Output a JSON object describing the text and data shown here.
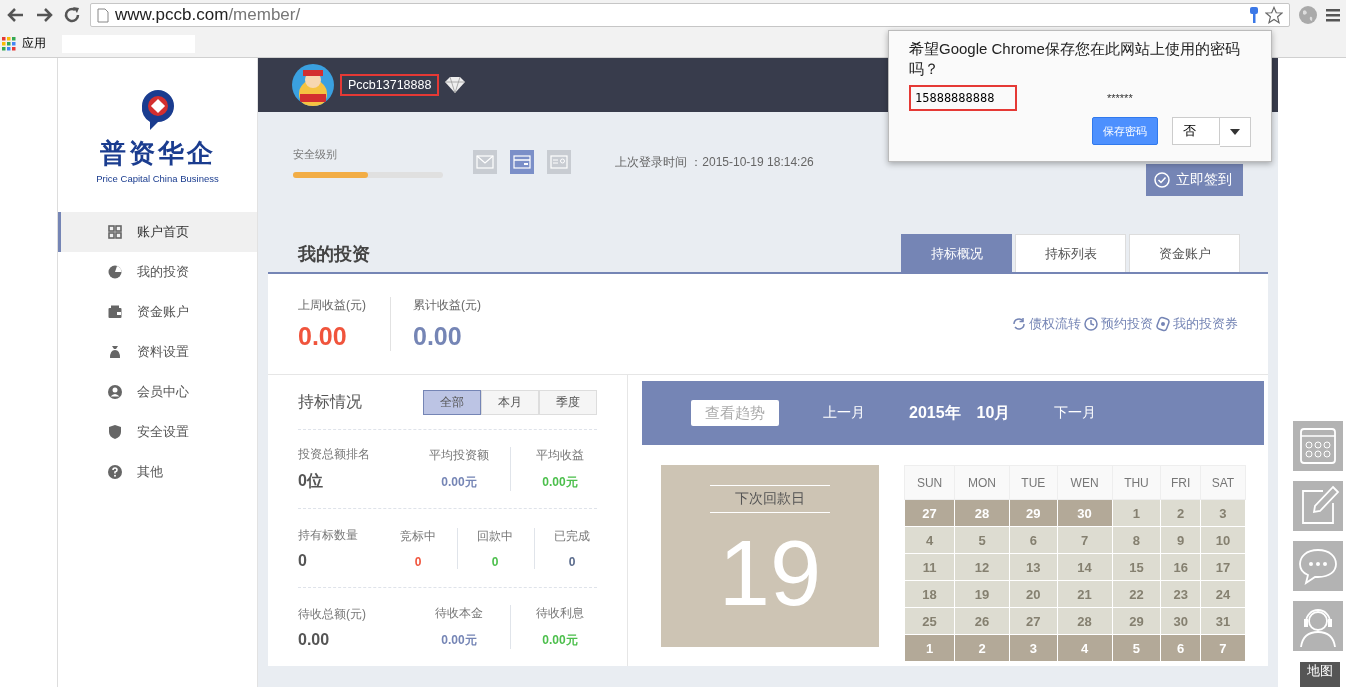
{
  "browser": {
    "url_host": "www.pccb.com",
    "url_path": "/member/",
    "bookmarks": [
      {
        "label": "应用"
      }
    ]
  },
  "sidebar": {
    "logo_name": "普资华企",
    "logo_tagline": "Price Capital China Business",
    "items": [
      {
        "kind": "grid",
        "label": "账户首页",
        "selected": true
      },
      {
        "kind": "pie",
        "label": "我的投资",
        "selected": false
      },
      {
        "kind": "wallet",
        "label": "资金账户",
        "selected": false
      },
      {
        "kind": "bag",
        "label": "资料设置",
        "selected": false
      },
      {
        "kind": "user",
        "label": "会员中心",
        "selected": false
      },
      {
        "kind": "shield",
        "label": "安全设置",
        "selected": false
      },
      {
        "kind": "help",
        "label": "其他",
        "selected": false
      }
    ]
  },
  "header": {
    "username": "Pccb13718888"
  },
  "security": {
    "label": "安全级别",
    "level": 0.5,
    "verifications": [
      {
        "kind": "email",
        "verified": false
      },
      {
        "kind": "card",
        "verified": true
      },
      {
        "kind": "id",
        "verified": false
      }
    ],
    "last_login": "上次登录时间 ：2015-10-19 18:14:26",
    "checkin_button": "立即签到"
  },
  "investment": {
    "title": "我的投资",
    "tabs": [
      {
        "label": "持标概况",
        "selected": true
      },
      {
        "label": "持标列表",
        "selected": false
      },
      {
        "label": "资金账户",
        "selected": false
      }
    ],
    "income": [
      {
        "label": "上周收益(元)",
        "value": "0.00",
        "color": "#f0543c"
      },
      {
        "label": "累计收益(元)",
        "value": "0.00",
        "color": "#7585b5"
      }
    ],
    "links": [
      {
        "kind": "transfer",
        "label": "债权流转"
      },
      {
        "kind": "clock",
        "label": "预约投资"
      },
      {
        "kind": "coupon",
        "label": "我的投资券"
      }
    ],
    "holdings": {
      "title": "持标情况",
      "filters": [
        {
          "label": "全部",
          "selected": true
        },
        {
          "label": "本月",
          "selected": false
        },
        {
          "label": "季度",
          "selected": false
        }
      ],
      "rows": [
        {
          "label": "投资总额排名",
          "value": "0位",
          "stats": [
            {
              "label": "平均投资额",
              "value": "0.00元",
              "color": "#7585b5"
            },
            {
              "label": "平均收益",
              "value": "0.00元",
              "color": "#4cbf4c"
            }
          ]
        },
        {
          "label": "持有标数量",
          "value": "0",
          "stats": [
            {
              "label": "竞标中",
              "value": "0",
              "color": "#f0543c"
            },
            {
              "label": "回款中",
              "value": "0",
              "color": "#4cbf4c"
            },
            {
              "label": "已完成",
              "value": "0",
              "color": "#5a6b8c"
            }
          ]
        },
        {
          "label": "待收总额(元)",
          "value": "0.00",
          "stats": [
            {
              "label": "待收本金",
              "value": "0.00元",
              "color": "#7585b5"
            },
            {
              "label": "待收利息",
              "value": "0.00元",
              "color": "#4cbf4c"
            }
          ]
        }
      ]
    },
    "calendar": {
      "trend_button": "查看趋势",
      "prev": "上一月",
      "year": "2015年",
      "month": "10月",
      "next": "下一月",
      "next_payment_label": "下次回款日",
      "next_payment_day": "19",
      "weekdays": [
        "SUN",
        "MON",
        "TUE",
        "WEN",
        "THU",
        "FRI",
        "SAT"
      ],
      "weeks": [
        [
          {
            "day": "27",
            "outside": true
          },
          {
            "day": "28",
            "outside": true
          },
          {
            "day": "29",
            "outside": true
          },
          {
            "day": "30",
            "outside": true
          },
          {
            "day": "1",
            "outside": false
          },
          {
            "day": "2",
            "outside": false
          },
          {
            "day": "3",
            "outside": false
          }
        ],
        [
          {
            "day": "4",
            "outside": false
          },
          {
            "day": "5",
            "outside": false
          },
          {
            "day": "6",
            "outside": false
          },
          {
            "day": "7",
            "outside": false
          },
          {
            "day": "8",
            "outside": false
          },
          {
            "day": "9",
            "outside": false
          },
          {
            "day": "10",
            "outside": false
          }
        ],
        [
          {
            "day": "11",
            "outside": false
          },
          {
            "day": "12",
            "outside": false
          },
          {
            "day": "13",
            "outside": false
          },
          {
            "day": "14",
            "outside": false
          },
          {
            "day": "15",
            "outside": false
          },
          {
            "day": "16",
            "outside": false
          },
          {
            "day": "17",
            "outside": false
          }
        ],
        [
          {
            "day": "18",
            "outside": false
          },
          {
            "day": "19",
            "outside": false
          },
          {
            "day": "20",
            "outside": false
          },
          {
            "day": "21",
            "outside": false
          },
          {
            "day": "22",
            "outside": false
          },
          {
            "day": "23",
            "outside": false
          },
          {
            "day": "24",
            "outside": false
          }
        ],
        [
          {
            "day": "25",
            "outside": false
          },
          {
            "day": "26",
            "outside": false
          },
          {
            "day": "27",
            "outside": false
          },
          {
            "day": "28",
            "outside": false
          },
          {
            "day": "29",
            "outside": false
          },
          {
            "day": "30",
            "outside": false
          },
          {
            "day": "31",
            "outside": false
          }
        ],
        [
          {
            "day": "1",
            "outside": true
          },
          {
            "day": "2",
            "outside": true
          },
          {
            "day": "3",
            "outside": true
          },
          {
            "day": "4",
            "outside": true
          },
          {
            "day": "5",
            "outside": true
          },
          {
            "day": "6",
            "outside": true
          },
          {
            "day": "7",
            "outside": true
          }
        ]
      ]
    }
  },
  "popup": {
    "message": "希望Google Chrome保存您在此网站上使用的密码吗？",
    "username": "15888888888",
    "password": "******",
    "save_button": "保存密码",
    "decline_button": "否"
  },
  "float_buttons": [
    {
      "kind": "calendar"
    },
    {
      "kind": "edit"
    },
    {
      "kind": "chat"
    },
    {
      "kind": "support"
    }
  ],
  "map_label": "地图"
}
